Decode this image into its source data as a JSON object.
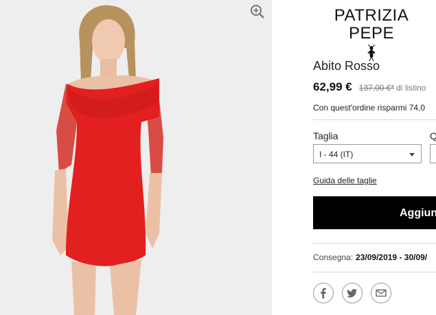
{
  "product": {
    "image_alt": "Model in red off-shoulder dress",
    "zoom_icon": "zoom-in-icon"
  },
  "brand": {
    "name": "PATRIZIA PEPE",
    "logo_icon": "bee-logo-icon"
  },
  "details": {
    "title": "Abito Rosso",
    "price": "62,99 €",
    "old_price": "137,00 €*",
    "list_note": "di listino",
    "savings": "Con quest'ordine risparmi 74,0"
  },
  "size": {
    "label": "Taglia",
    "selected": "I - 44 (IT)",
    "guide_link": "Guida delle taglie"
  },
  "quantity": {
    "label": "Q"
  },
  "cart": {
    "button_label": "Aggiun"
  },
  "delivery": {
    "label": "Consegna:",
    "dates": "23/09/2019 - 30/09/"
  },
  "share": {
    "icons": [
      "facebook-icon",
      "twitter-icon",
      "email-icon"
    ]
  },
  "colors": {
    "dress": "#e1201f",
    "button": "#000000",
    "photo_bg": "#eeeeef"
  }
}
